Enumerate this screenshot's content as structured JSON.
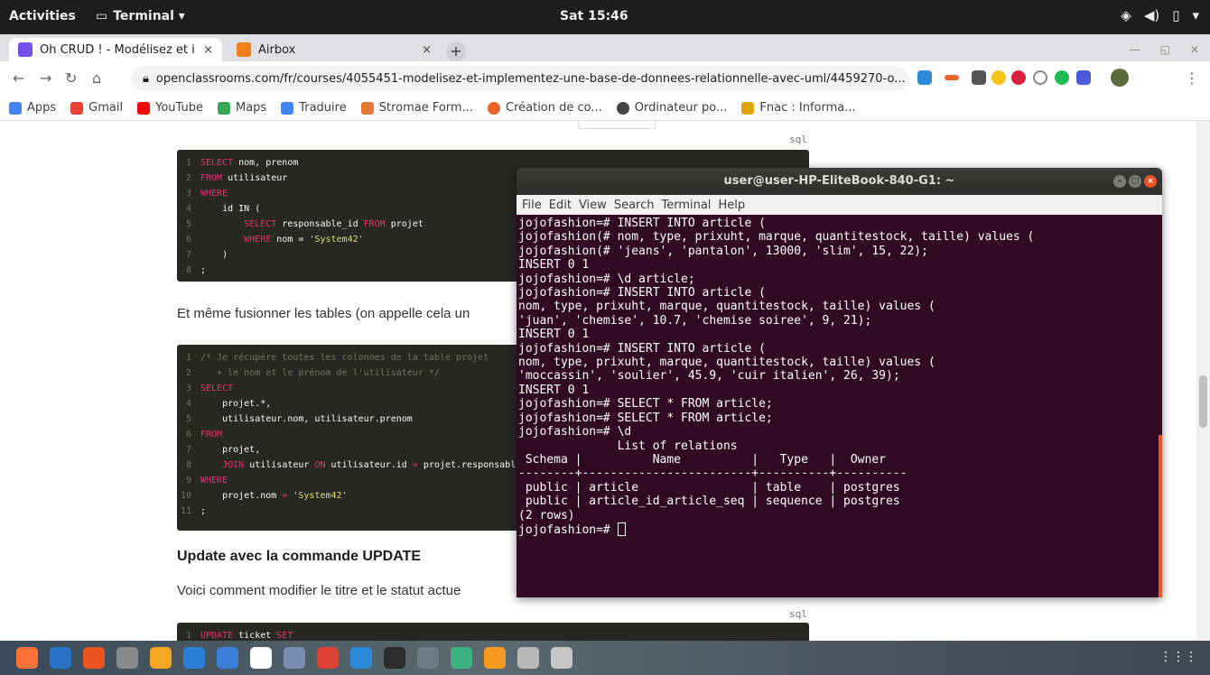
{
  "topbar": {
    "activities": "Activities",
    "app_name": "Terminal ▾",
    "clock": "Sat 15:46"
  },
  "browser": {
    "tabs": [
      {
        "label": "Oh CRUD ! - Modélisez et i",
        "close": "×",
        "fav_color": "#7451eb"
      },
      {
        "label": "Airbox",
        "close": "×",
        "fav_color": "#f07f1c"
      }
    ],
    "new_tab": "+",
    "url": "openclassrooms.com/fr/courses/4055451-modelisez-et-implementez-une-base-de-donnees-relationnelle-avec-uml/4459270-o...",
    "bookmarks": [
      {
        "label": "Apps",
        "color": "#4285f4"
      },
      {
        "label": "Gmail",
        "color": "#ea4335"
      },
      {
        "label": "YouTube",
        "color": "#ff0000"
      },
      {
        "label": "Maps",
        "color": "#34a853"
      },
      {
        "label": "Traduire",
        "color": "#4285f4"
      },
      {
        "label": "Stromae Form...",
        "color": "#e07b39"
      },
      {
        "label": "Création de co...",
        "color": "#e8632a"
      },
      {
        "label": "Ordinateur po...",
        "color": "#444444"
      },
      {
        "label": "Fnac : Informa...",
        "color": "#e1a500"
      }
    ]
  },
  "page": {
    "lang_label_1": "sql",
    "lang_label_2": "sql",
    "code1": [
      {
        "n": "1",
        "parts": [
          [
            "kw",
            "SELECT"
          ],
          [
            "t",
            " nom, prenom"
          ]
        ]
      },
      {
        "n": "2",
        "parts": [
          [
            "kw",
            "FROM"
          ],
          [
            "t",
            " utilisateur"
          ]
        ]
      },
      {
        "n": "3",
        "parts": [
          [
            "kw",
            "WHERE"
          ]
        ]
      },
      {
        "n": "4",
        "parts": [
          [
            "t",
            "    id IN ("
          ]
        ]
      },
      {
        "n": "5",
        "parts": [
          [
            "t",
            "        "
          ],
          [
            "kw",
            "SELECT"
          ],
          [
            "t",
            " responsable_id "
          ],
          [
            "kw",
            "FROM"
          ],
          [
            "t",
            " projet"
          ]
        ]
      },
      {
        "n": "6",
        "parts": [
          [
            "t",
            "        "
          ],
          [
            "kw",
            "WHERE"
          ],
          [
            "t",
            " nom = "
          ],
          [
            "str",
            "'System42'"
          ]
        ]
      },
      {
        "n": "7",
        "parts": [
          [
            "t",
            "    )"
          ]
        ]
      },
      {
        "n": "8",
        "parts": [
          [
            "t",
            ";"
          ]
        ]
      }
    ],
    "para1": "Et même fusionner les tables (on appelle cela un",
    "code2": [
      {
        "n": "1",
        "parts": [
          [
            "com",
            "/* Je récupère toutes les colonnes de la table projet"
          ]
        ]
      },
      {
        "n": "2",
        "parts": [
          [
            "com",
            "   + le nom et le prénom de l'utilisateur */"
          ]
        ]
      },
      {
        "n": "3",
        "parts": [
          [
            "kw",
            "SELECT"
          ]
        ]
      },
      {
        "n": "4",
        "parts": [
          [
            "t",
            "    projet.*,"
          ]
        ]
      },
      {
        "n": "5",
        "parts": [
          [
            "t",
            "    utilisateur.nom, utilisateur.prenom"
          ]
        ]
      },
      {
        "n": "6",
        "parts": [
          [
            "kw",
            "FROM"
          ]
        ]
      },
      {
        "n": "7",
        "parts": [
          [
            "t",
            "    projet,"
          ]
        ]
      },
      {
        "n": "8",
        "parts": [
          [
            "t",
            "    "
          ],
          [
            "kw",
            "JOIN"
          ],
          [
            "t",
            " utilisateur "
          ],
          [
            "kw",
            "ON"
          ],
          [
            "t",
            " utilisateur.id "
          ],
          [
            "kw",
            "="
          ],
          [
            "t",
            " projet.responsable"
          ]
        ]
      },
      {
        "n": "9",
        "parts": [
          [
            "kw",
            "WHERE"
          ]
        ]
      },
      {
        "n": "10",
        "parts": [
          [
            "t",
            "    projet.nom "
          ],
          [
            "kw",
            "="
          ],
          [
            "t",
            " "
          ],
          [
            "str",
            "'System42'"
          ]
        ]
      },
      {
        "n": "11",
        "parts": [
          [
            "t",
            ";"
          ]
        ]
      }
    ],
    "heading": "Update avec la commande UPDATE",
    "para2": "Voici comment modifier le titre et le statut actue",
    "code3": [
      {
        "n": "1",
        "parts": [
          [
            "kw",
            "UPDATE"
          ],
          [
            "t",
            " ticket "
          ],
          [
            "kw",
            "SET"
          ]
        ]
      }
    ]
  },
  "terminal": {
    "title": "user@user-HP-EliteBook-840-G1: ~",
    "menu": [
      "File",
      "Edit",
      "View",
      "Search",
      "Terminal",
      "Help"
    ],
    "lines": [
      "jojofashion=# INSERT INTO article (",
      "jojofashion(# nom, type, prixuht, marque, quantitestock, taille) values (",
      "jojofashion(# 'jeans', 'pantalon', 13000, 'slim', 15, 22);",
      "INSERT 0 1",
      "jojofashion=# \\d article;",
      "jojofashion=# INSERT INTO article (",
      "nom, type, prixuht, marque, quantitestock, taille) values (",
      "'juan', 'chemise', 10.7, 'chemise soiree', 9, 21);",
      "INSERT 0 1",
      "jojofashion=# INSERT INTO article (",
      "nom, type, prixuht, marque, quantitestock, taille) values (",
      "'moccassin', 'soulier', 45.9, 'cuir italien', 26, 39);",
      "INSERT 0 1",
      "jojofashion=# SELECT * FROM article;",
      "jojofashion=# SELECT * FROM article;",
      "jojofashion=# \\d",
      "              List of relations",
      " Schema |          Name          |   Type   |  Owner",
      "--------+------------------------+----------+----------",
      " public | article                | table    | postgres",
      " public | article_id_article_seq | sequence | postgres",
      "(2 rows)",
      ""
    ],
    "prompt": "jojofashion=# "
  },
  "dock": {
    "icons": [
      {
        "name": "firefox-icon",
        "color": "#ff7139"
      },
      {
        "name": "thunderbird-icon",
        "color": "#2a72c8"
      },
      {
        "name": "software-icon",
        "color": "#e95420"
      },
      {
        "name": "files-icon",
        "color": "#8a8a8a"
      },
      {
        "name": "rhythmbox-icon",
        "color": "#f5a623"
      },
      {
        "name": "writer-icon",
        "color": "#2a7fd6"
      },
      {
        "name": "help-icon",
        "color": "#3b7dd8"
      },
      {
        "name": "amazon-icon",
        "color": "#ffffff"
      },
      {
        "name": "calendar-icon",
        "color": "#7a8fb0"
      },
      {
        "name": "chrome-icon",
        "color": "#db4437"
      },
      {
        "name": "vscode-icon",
        "color": "#2b8ad8"
      },
      {
        "name": "terminal-icon",
        "color": "#2c2c2c"
      },
      {
        "name": "screen-icon",
        "color": "#6d7b86"
      },
      {
        "name": "atom-icon",
        "color": "#3fb37f"
      },
      {
        "name": "sublime-icon",
        "color": "#f79a1e"
      },
      {
        "name": "database-icon",
        "color": "#b8b8b8"
      },
      {
        "name": "screenshot-icon",
        "color": "#c7c7c7"
      }
    ],
    "apps_grid": "⋮⋮⋮"
  }
}
